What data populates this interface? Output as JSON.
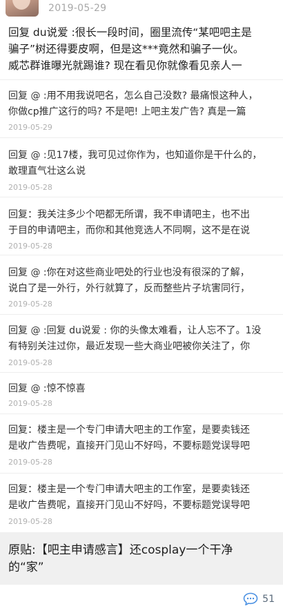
{
  "post": {
    "date": "2019-05-29",
    "lines": [
      "回复 du说爱 :很长一段时间，圈里流传“某吧吧主是",
      "骗子”树还得要皮啊，但是这***竟然和骗子一伙。",
      "威芯群谁曝光就踢谁? 现在看见你就像看见亲人一"
    ]
  },
  "comments": [
    {
      "lines": [
        "回复 @ :用不用我说吧名，怎么自己没数? 最痛恨这种人，",
        "你做cp推广这行的吗? 不是吧! 上吧主发广告? 真是一篇"
      ],
      "date": "2019-05-29"
    },
    {
      "lines": [
        "回复 @ :见17楼，我可见过你作为，也知道你是干什么的，",
        "敢理直气壮这么说"
      ],
      "date": "2019-05-28"
    },
    {
      "lines": [
        "回复：我关注多少个吧都无所谓，我不申请吧主，也不出",
        "于目的申请吧主，而你和其他竞选人不同啊，这不是在说"
      ],
      "date": "2019-05-28"
    },
    {
      "lines": [
        "回复 @ :你在对这些商业吧处的行业也没有很深的了解，",
        "说白了是一外行，外行就算了，反而整些片子坑害同行，"
      ],
      "date": "2019-05-28"
    },
    {
      "lines": [
        "回复 @ :回复 du说爱 : 你的头像太难看，让人忘不了。1没",
        "有特别关注过你，最近发现一些大商业吧被你关注了，你"
      ],
      "date": "2019-05-28"
    },
    {
      "lines": [
        "回复 @ :惊不惊喜"
      ],
      "date": "2019-05-28"
    },
    {
      "lines": [
        "回复：楼主是一个专门申请大吧主的工作室，是要卖钱还",
        "是收广告费呢，直接开门见山不好吗，不要标题党误导吧"
      ],
      "date": "2019-05-28"
    },
    {
      "lines": [
        "回复：楼主是一个专门申请大吧主的工作室，是要卖钱还",
        "是收广告费呢，直接开门见山不好吗，不要标题党误导吧"
      ],
      "date": "2019-05-28"
    }
  ],
  "origin": {
    "lines": [
      "原贴:【吧主申请感言】还cosplay一个干净",
      "的“家”"
    ]
  },
  "footer": {
    "reply_count": "51",
    "icon": "comment-bubble-icon",
    "icon_color": "#4a90e2"
  }
}
